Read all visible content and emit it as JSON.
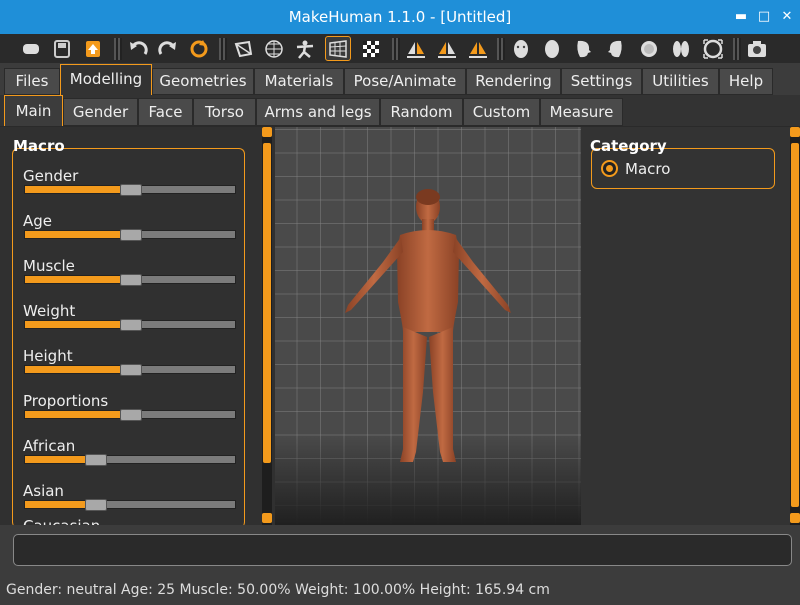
{
  "window": {
    "title": "MakeHuman 1.1.0 - [Untitled]",
    "min_glyph": "▬",
    "max_glyph": "□",
    "close_glyph": "✕"
  },
  "toolbar": {
    "icons": [
      "undo-icon",
      "redo-icon",
      "reset-icon"
    ]
  },
  "main_tabs": [
    "Files",
    "Modelling",
    "Geometries",
    "Materials",
    "Pose/Animate",
    "Rendering",
    "Settings",
    "Utilities",
    "Help"
  ],
  "sub_tabs": [
    "Main",
    "Gender",
    "Face",
    "Torso",
    "Arms and legs",
    "Random",
    "Custom",
    "Measure"
  ],
  "macro": {
    "title": "Macro",
    "sliders": [
      {
        "label": "Gender",
        "value": 0.5
      },
      {
        "label": "Age",
        "value": 0.5
      },
      {
        "label": "Muscle",
        "value": 0.5
      },
      {
        "label": "Weight",
        "value": 0.5
      },
      {
        "label": "Height",
        "value": 0.5
      },
      {
        "label": "Proportions",
        "value": 0.5
      },
      {
        "label": "African",
        "value": 0.333
      },
      {
        "label": "Asian",
        "value": 0.333
      }
    ],
    "cut_label": "Caucasian"
  },
  "category": {
    "title": "Category",
    "option": "Macro"
  },
  "status": "Gender: neutral Age: 25 Muscle: 50.00% Weight: 100.00% Height: 165.94 cm",
  "colors": {
    "accent": "#f39a1c",
    "titlebar": "#1f8fd8",
    "skin": "#b5603a"
  }
}
